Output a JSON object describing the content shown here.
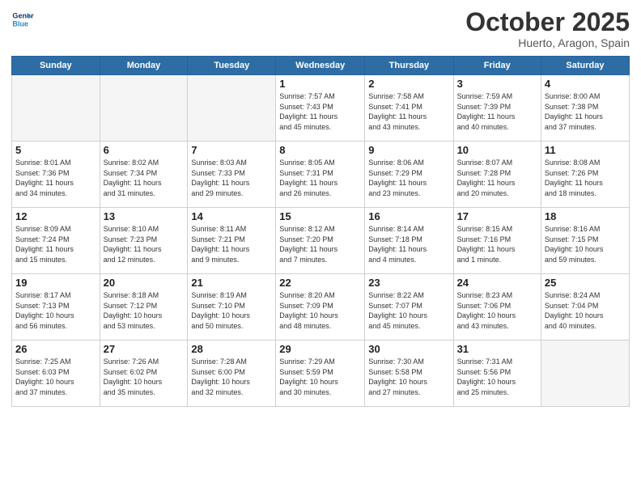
{
  "header": {
    "logo_line1": "General",
    "logo_line2": "Blue",
    "month": "October 2025",
    "location": "Huerto, Aragon, Spain"
  },
  "weekdays": [
    "Sunday",
    "Monday",
    "Tuesday",
    "Wednesday",
    "Thursday",
    "Friday",
    "Saturday"
  ],
  "weeks": [
    [
      {
        "day": "",
        "info": ""
      },
      {
        "day": "",
        "info": ""
      },
      {
        "day": "",
        "info": ""
      },
      {
        "day": "1",
        "info": "Sunrise: 7:57 AM\nSunset: 7:43 PM\nDaylight: 11 hours\nand 45 minutes."
      },
      {
        "day": "2",
        "info": "Sunrise: 7:58 AM\nSunset: 7:41 PM\nDaylight: 11 hours\nand 43 minutes."
      },
      {
        "day": "3",
        "info": "Sunrise: 7:59 AM\nSunset: 7:39 PM\nDaylight: 11 hours\nand 40 minutes."
      },
      {
        "day": "4",
        "info": "Sunrise: 8:00 AM\nSunset: 7:38 PM\nDaylight: 11 hours\nand 37 minutes."
      }
    ],
    [
      {
        "day": "5",
        "info": "Sunrise: 8:01 AM\nSunset: 7:36 PM\nDaylight: 11 hours\nand 34 minutes."
      },
      {
        "day": "6",
        "info": "Sunrise: 8:02 AM\nSunset: 7:34 PM\nDaylight: 11 hours\nand 31 minutes."
      },
      {
        "day": "7",
        "info": "Sunrise: 8:03 AM\nSunset: 7:33 PM\nDaylight: 11 hours\nand 29 minutes."
      },
      {
        "day": "8",
        "info": "Sunrise: 8:05 AM\nSunset: 7:31 PM\nDaylight: 11 hours\nand 26 minutes."
      },
      {
        "day": "9",
        "info": "Sunrise: 8:06 AM\nSunset: 7:29 PM\nDaylight: 11 hours\nand 23 minutes."
      },
      {
        "day": "10",
        "info": "Sunrise: 8:07 AM\nSunset: 7:28 PM\nDaylight: 11 hours\nand 20 minutes."
      },
      {
        "day": "11",
        "info": "Sunrise: 8:08 AM\nSunset: 7:26 PM\nDaylight: 11 hours\nand 18 minutes."
      }
    ],
    [
      {
        "day": "12",
        "info": "Sunrise: 8:09 AM\nSunset: 7:24 PM\nDaylight: 11 hours\nand 15 minutes."
      },
      {
        "day": "13",
        "info": "Sunrise: 8:10 AM\nSunset: 7:23 PM\nDaylight: 11 hours\nand 12 minutes."
      },
      {
        "day": "14",
        "info": "Sunrise: 8:11 AM\nSunset: 7:21 PM\nDaylight: 11 hours\nand 9 minutes."
      },
      {
        "day": "15",
        "info": "Sunrise: 8:12 AM\nSunset: 7:20 PM\nDaylight: 11 hours\nand 7 minutes."
      },
      {
        "day": "16",
        "info": "Sunrise: 8:14 AM\nSunset: 7:18 PM\nDaylight: 11 hours\nand 4 minutes."
      },
      {
        "day": "17",
        "info": "Sunrise: 8:15 AM\nSunset: 7:16 PM\nDaylight: 11 hours\nand 1 minute."
      },
      {
        "day": "18",
        "info": "Sunrise: 8:16 AM\nSunset: 7:15 PM\nDaylight: 10 hours\nand 59 minutes."
      }
    ],
    [
      {
        "day": "19",
        "info": "Sunrise: 8:17 AM\nSunset: 7:13 PM\nDaylight: 10 hours\nand 56 minutes."
      },
      {
        "day": "20",
        "info": "Sunrise: 8:18 AM\nSunset: 7:12 PM\nDaylight: 10 hours\nand 53 minutes."
      },
      {
        "day": "21",
        "info": "Sunrise: 8:19 AM\nSunset: 7:10 PM\nDaylight: 10 hours\nand 50 minutes."
      },
      {
        "day": "22",
        "info": "Sunrise: 8:20 AM\nSunset: 7:09 PM\nDaylight: 10 hours\nand 48 minutes."
      },
      {
        "day": "23",
        "info": "Sunrise: 8:22 AM\nSunset: 7:07 PM\nDaylight: 10 hours\nand 45 minutes."
      },
      {
        "day": "24",
        "info": "Sunrise: 8:23 AM\nSunset: 7:06 PM\nDaylight: 10 hours\nand 43 minutes."
      },
      {
        "day": "25",
        "info": "Sunrise: 8:24 AM\nSunset: 7:04 PM\nDaylight: 10 hours\nand 40 minutes."
      }
    ],
    [
      {
        "day": "26",
        "info": "Sunrise: 7:25 AM\nSunset: 6:03 PM\nDaylight: 10 hours\nand 37 minutes."
      },
      {
        "day": "27",
        "info": "Sunrise: 7:26 AM\nSunset: 6:02 PM\nDaylight: 10 hours\nand 35 minutes."
      },
      {
        "day": "28",
        "info": "Sunrise: 7:28 AM\nSunset: 6:00 PM\nDaylight: 10 hours\nand 32 minutes."
      },
      {
        "day": "29",
        "info": "Sunrise: 7:29 AM\nSunset: 5:59 PM\nDaylight: 10 hours\nand 30 minutes."
      },
      {
        "day": "30",
        "info": "Sunrise: 7:30 AM\nSunset: 5:58 PM\nDaylight: 10 hours\nand 27 minutes."
      },
      {
        "day": "31",
        "info": "Sunrise: 7:31 AM\nSunset: 5:56 PM\nDaylight: 10 hours\nand 25 minutes."
      },
      {
        "day": "",
        "info": ""
      }
    ]
  ]
}
